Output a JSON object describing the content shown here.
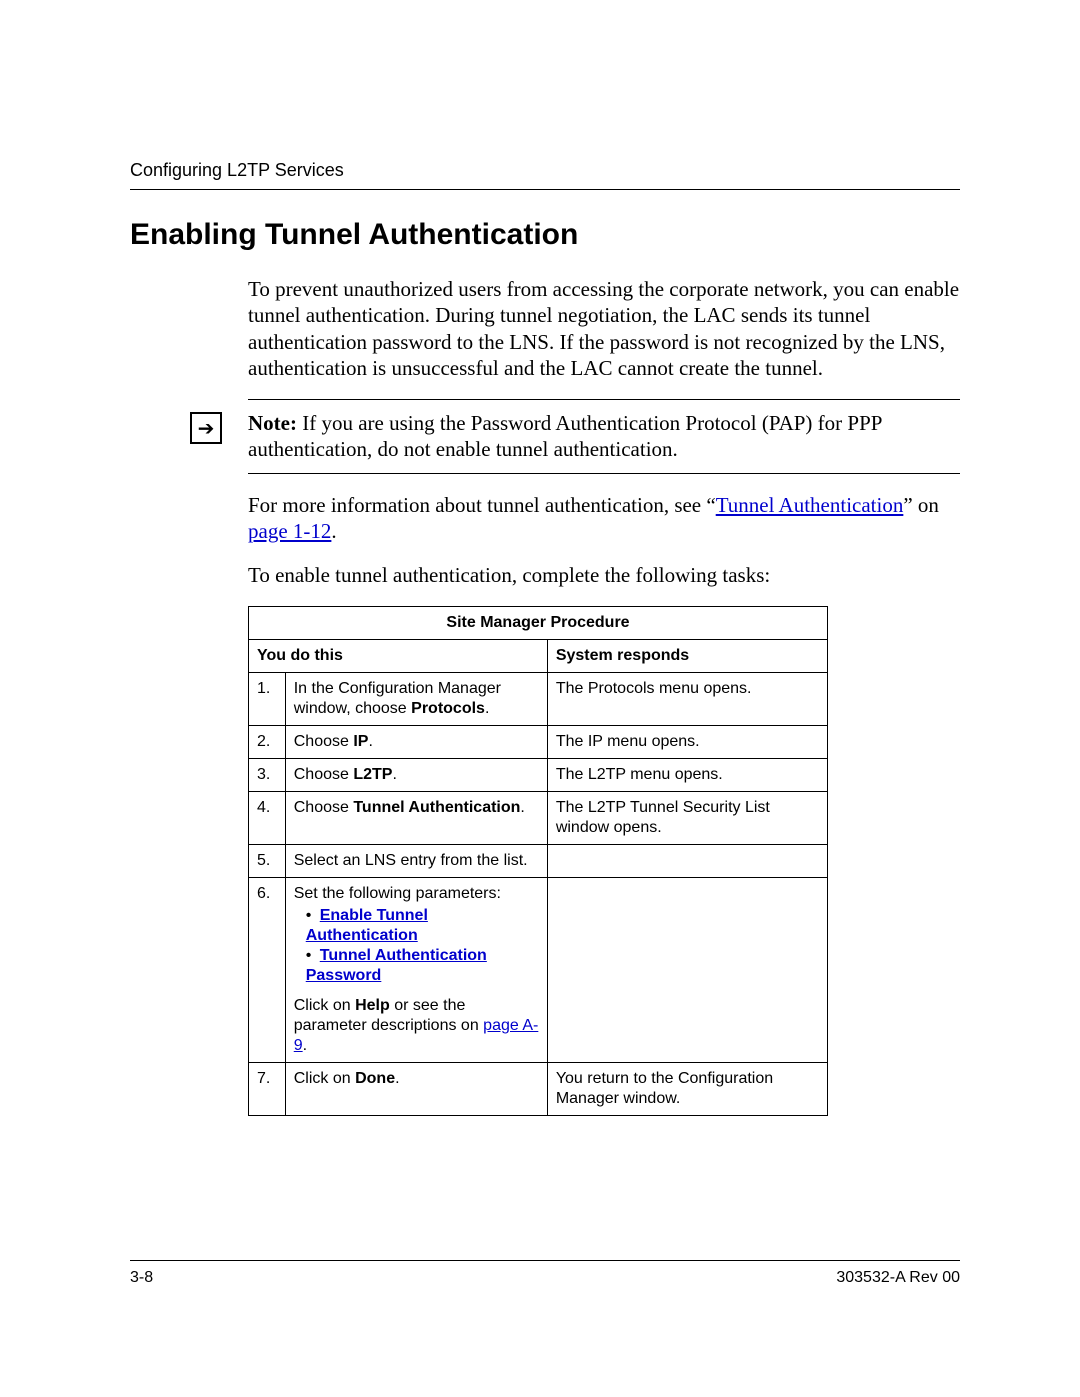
{
  "header": {
    "running": "Configuring L2TP Services"
  },
  "title": "Enabling Tunnel Authentication",
  "intro": "To prevent unauthorized users from accessing the corporate network, you can enable tunnel authentication. During tunnel negotiation, the LAC sends its tunnel authentication password to the LNS. If the password is not recognized by the LNS, authentication is unsuccessful and the LAC cannot create the tunnel.",
  "note": {
    "label": "Note:",
    "text": " If you are using the Password Authentication Protocol (PAP) for PPP authentication, do not enable tunnel authentication."
  },
  "more_info": {
    "pre": "For more information about tunnel authentication, see “",
    "link1": "Tunnel Authentication",
    "mid": "” on ",
    "link2": "page 1-12",
    "post": "."
  },
  "tasks_lead": "To enable tunnel authentication, complete the following tasks:",
  "table": {
    "caption": "Site Manager Procedure",
    "col1": "You do this",
    "col2": "System responds",
    "rows": [
      {
        "n": "1.",
        "a_pre": "In the Configuration Manager window, choose ",
        "a_bold": "Protocols",
        "a_post": ".",
        "r": "The Protocols menu opens."
      },
      {
        "n": "2.",
        "a_pre": "Choose ",
        "a_bold": "IP",
        "a_post": ".",
        "r": "The IP menu opens."
      },
      {
        "n": "3.",
        "a_pre": "Choose ",
        "a_bold": "L2TP",
        "a_post": ".",
        "r": "The L2TP menu opens."
      },
      {
        "n": "4.",
        "a_pre": "Choose ",
        "a_bold": "Tunnel Authentication",
        "a_post": ".",
        "r": "The L2TP Tunnel Security List window opens."
      },
      {
        "n": "5.",
        "a_pre": "Select an LNS entry from the list.",
        "a_bold": "",
        "a_post": "",
        "r": ""
      },
      {
        "n": "6.",
        "a_pre": "Set the following parameters:",
        "a_bold": "",
        "a_post": "",
        "r": "",
        "params": [
          "Enable Tunnel Authentication",
          "Tunnel Authentication Password"
        ],
        "help_pre": "Click on ",
        "help_bold": "Help",
        "help_mid": " or see the parameter descriptions on ",
        "help_link": "page A-9",
        "help_post": "."
      },
      {
        "n": "7.",
        "a_pre": "Click on ",
        "a_bold": "Done",
        "a_post": ".",
        "r": "You return to the Configuration Manager window."
      }
    ]
  },
  "footer": {
    "left": "3-8",
    "right": "303532-A Rev 00"
  }
}
